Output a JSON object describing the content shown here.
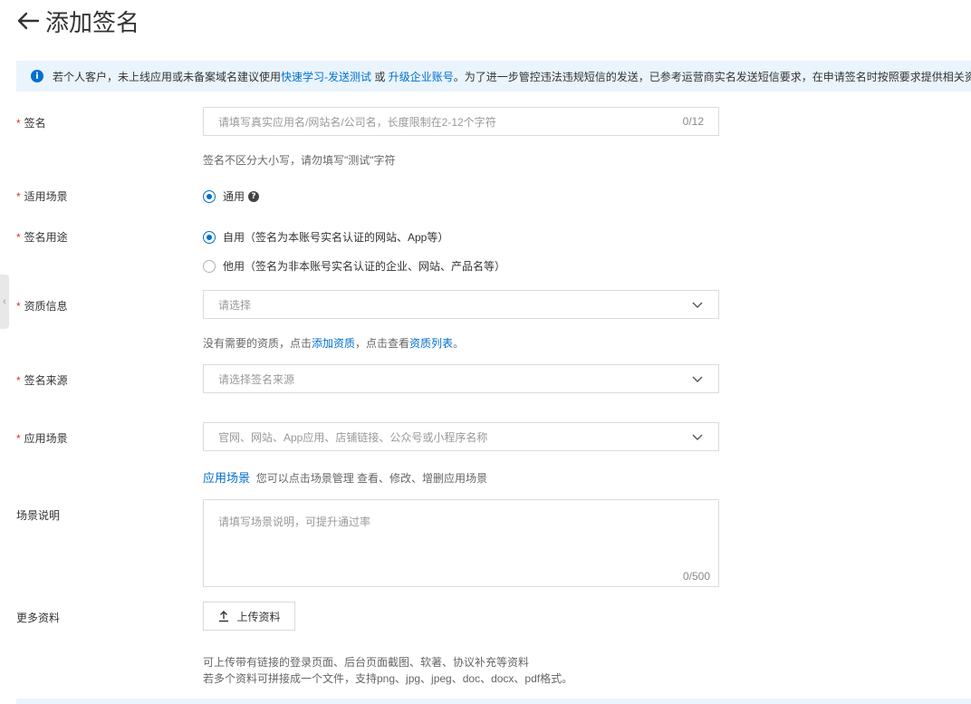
{
  "header": {
    "title": "添加签名"
  },
  "notice": {
    "prefix": "若个人客户，未上线应用或未备案域名建议使用",
    "link1": "快速学习-发送测试",
    "or": "或",
    "link2": "升级企业账号",
    "suffix": "。为了进一步管控违法违规短信的发送，已参考运营商实名发送短信要求，在申请签名时按照要求提供相关资"
  },
  "form": {
    "signature": {
      "label": "签名",
      "placeholder": "请填写真实应用名/网站名/公司名，长度限制在2-12个字符",
      "counter": "0/12",
      "hint": "签名不区分大小写，请勿填写\"测试\"字符"
    },
    "scenario": {
      "label": "适用场景",
      "option": "通用"
    },
    "purpose": {
      "label": "签名用途",
      "option_self": "自用（签名为本账号实名认证的网站、App等）",
      "option_other": "他用（签名为非本账号实名认证的企业、网站、产品名等）"
    },
    "qualification": {
      "label": "资质信息",
      "placeholder": "请选择",
      "hint_prefix": "没有需要的资质，点击",
      "hint_link1": "添加资质",
      "hint_mid": "，点击查看",
      "hint_link2": "资质列表",
      "hint_end": "。"
    },
    "source": {
      "label": "签名来源",
      "placeholder": "请选择签名来源"
    },
    "app_scene": {
      "label": "应用场景",
      "placeholder": "官网、网站、App应用、店铺链接、公众号或小程序名称",
      "hint_link": "应用场景",
      "hint_text": "您可以点击场景管理 查看、修改、增删应用场景"
    },
    "scene_desc": {
      "label": "场景说明",
      "placeholder": "请填写场景说明，可提升通过率",
      "counter": "0/500"
    },
    "more_docs": {
      "label": "更多资料",
      "button": "上传资料",
      "hint_line1": "可上传带有链接的登录页面、后台页面截图、软著、协议补充等资料",
      "hint_line2": "若多个资料可拼接成一个文件，支持png、jpg、jpeg、doc、docx、pdf格式。"
    }
  },
  "colors": {
    "accent": "#0070cc",
    "required": "#d93026",
    "notice_bg": "#eaf4fd"
  }
}
